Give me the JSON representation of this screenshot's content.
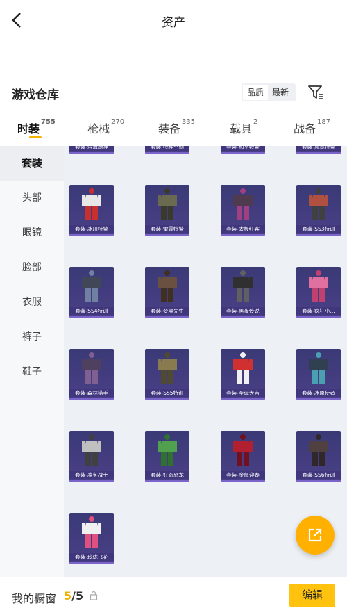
{
  "header": {
    "title": "资产"
  },
  "section": {
    "title": "游戏仓库"
  },
  "sort": {
    "options": [
      "品质",
      "最新"
    ]
  },
  "tabs": [
    {
      "label": "时装",
      "count": "755"
    },
    {
      "label": "枪械",
      "count": "270"
    },
    {
      "label": "装备",
      "count": "335"
    },
    {
      "label": "载具",
      "count": "2"
    },
    {
      "label": "战备",
      "count": "187"
    }
  ],
  "sidebar": {
    "items": [
      "套装",
      "头部",
      "眼镜",
      "脸部",
      "衣服",
      "裤子",
      "鞋子"
    ]
  },
  "grid": {
    "top_partial_labels": [
      "套装-滨海厨神",
      "套装-特种空勤",
      "套装-和平特警",
      "套装-风暴特警"
    ],
    "items": [
      "套装-冰川特警",
      "套装-雷霆特警",
      "套装-太极红客",
      "套装-SS3特训",
      "套装-SS4特训",
      "套装-梦魇先生",
      "套装-黑夜传说",
      "套装-疯狂小...",
      "套装-森林猎手",
      "套装-SS5特训",
      "套装-圣诞大吉",
      "套装-冰原使者",
      "套装-凛冬战士",
      "套装-好奇恐龙",
      "套装-金鼠迎春",
      "套装-SS6特训",
      "套装-玲珑飞花"
    ]
  },
  "bottom": {
    "label": "我的橱窗",
    "current": "5",
    "separator": "/",
    "total": "5",
    "edit_label": "编辑"
  },
  "colors": {
    "accent": "#ffc20e",
    "fab": "#ffb000",
    "card_bg": "#3a3a76"
  }
}
